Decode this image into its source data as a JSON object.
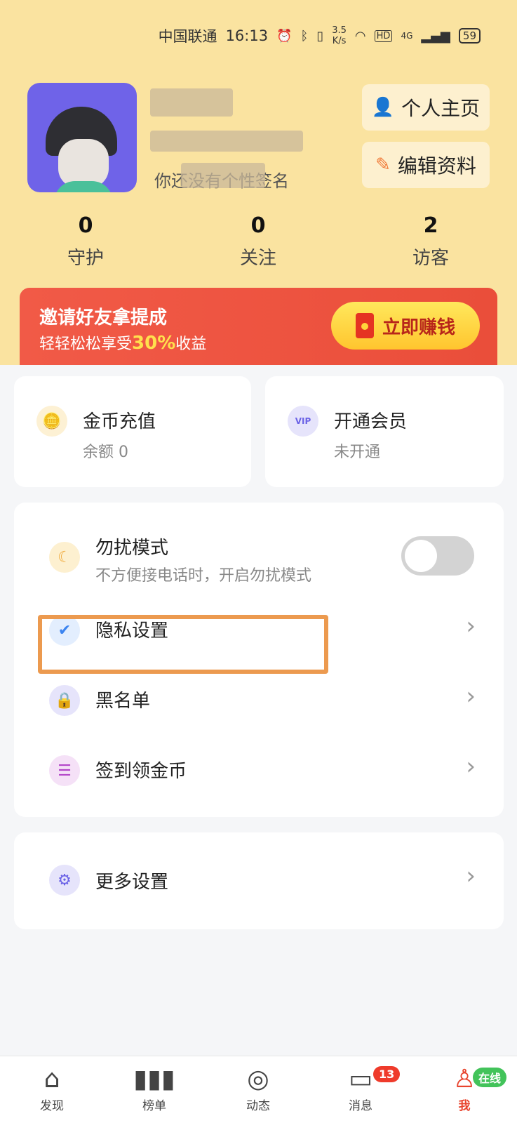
{
  "status_bar": {
    "carrier": "中国联通",
    "time": "16:13",
    "speed": "3.5",
    "speed_unit": "K/s",
    "network": "4G",
    "hd": "HD",
    "battery": "59"
  },
  "profile": {
    "signature": "你还没有个性签名",
    "homepage_button": "个人主页",
    "edit_button": "编辑资料"
  },
  "stats": [
    {
      "value": "0",
      "label": "守护"
    },
    {
      "value": "0",
      "label": "关注"
    },
    {
      "value": "2",
      "label": "访客"
    }
  ],
  "invite_banner": {
    "title": "邀请好友拿提成",
    "subtitle_prefix": "轻轻松松享受",
    "subtitle_highlight": "30%",
    "subtitle_suffix": "收益",
    "button": "立即赚钱"
  },
  "wallet": {
    "coins_title": "金币充值",
    "coins_sub": "余额 0",
    "vip_title": "开通会员",
    "vip_sub": "未开通",
    "vip_badge": "VIP"
  },
  "settings": {
    "dnd_title": "勿扰模式",
    "dnd_sub": "不方便接电话时，开启勿扰模式",
    "dnd_enabled": false,
    "privacy": "隐私设置",
    "blacklist": "黑名单",
    "checkin": "签到领金币",
    "more": "更多设置"
  },
  "tabbar": {
    "discover": "发现",
    "ranking": "榜单",
    "moments": "动态",
    "messages": "消息",
    "messages_badge": "13",
    "me": "我",
    "me_badge": "在线"
  },
  "colors": {
    "header_bg": "#fae3a0",
    "accent_red": "#ea4e3a",
    "accent_orange": "#f07a38",
    "highlight_box": "#ec9a4f"
  }
}
